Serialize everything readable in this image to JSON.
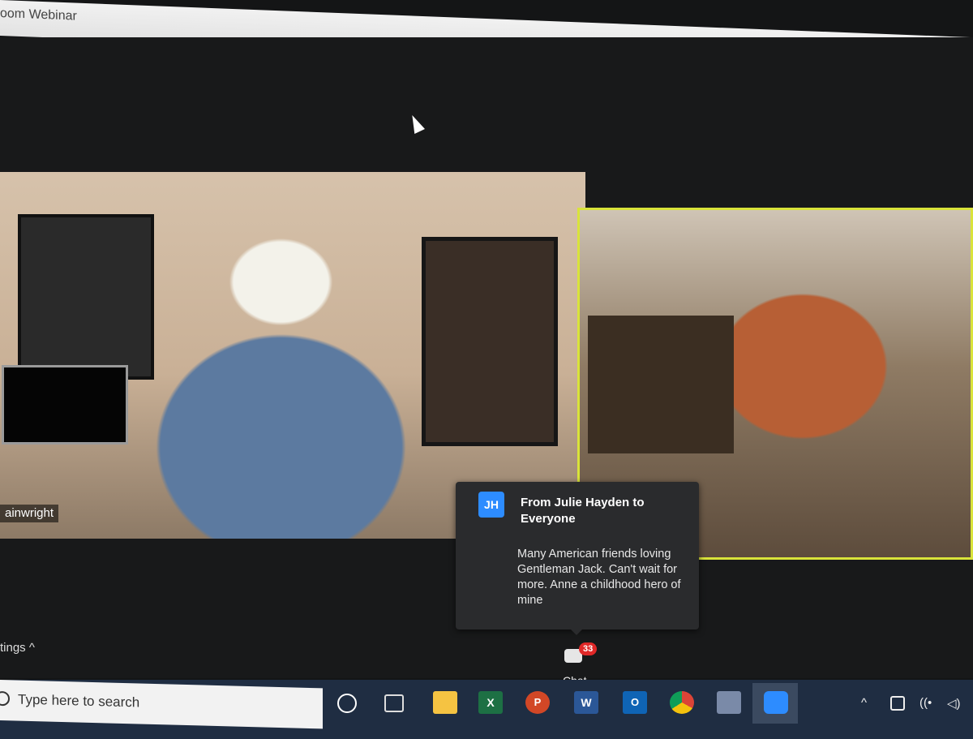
{
  "window": {
    "title": "oom Webinar"
  },
  "participants": [
    {
      "name_tag": "ainwright"
    }
  ],
  "chat_notification": {
    "avatar_initials": "JH",
    "from": "From Julie Hayden to Everyone",
    "message": "Many American friends loving Gentleman Jack. Can't wait for more. Anne a childhood hero of mine"
  },
  "toolbar": {
    "settings_label": "tings",
    "settings_chevron": "^",
    "chat_label": "Chat",
    "chat_badge": "33"
  },
  "taskbar": {
    "search_placeholder": "Type here to search",
    "excel_letter": "X",
    "ppt_letter": "P",
    "word_letter": "W",
    "outlook_letter": "O",
    "tray_up": "^",
    "tray_wifi": "((•",
    "tray_volume": "◁)"
  },
  "colors": {
    "active_speaker_border": "#d9e33a",
    "zoom_blue": "#2d8cff",
    "badge_red": "#e02828"
  }
}
